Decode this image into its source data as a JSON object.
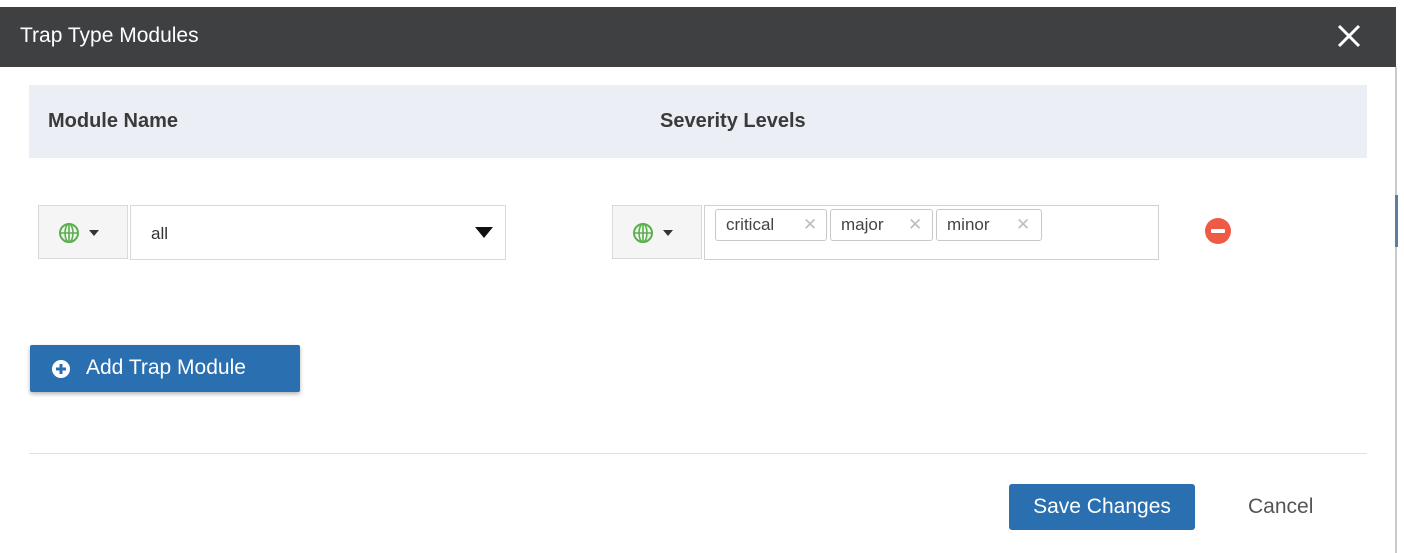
{
  "dialog": {
    "title": "Trap Type Modules"
  },
  "table": {
    "columns": [
      "Module Name",
      "Severity Levels"
    ],
    "rows": [
      {
        "module_scope_icon": "globe-icon",
        "module_value": "all",
        "severity_scope_icon": "globe-icon",
        "severity_tags": [
          "critical",
          "major",
          "minor"
        ]
      }
    ]
  },
  "actions": {
    "add_label": "Add Trap Module",
    "save_label": "Save Changes",
    "cancel_label": "Cancel"
  },
  "colors": {
    "header_bg": "#3f4042",
    "primary": "#2a70b0",
    "danger": "#ef5a45",
    "globe": "#58b14a",
    "table_header_bg": "#ebeff5"
  }
}
